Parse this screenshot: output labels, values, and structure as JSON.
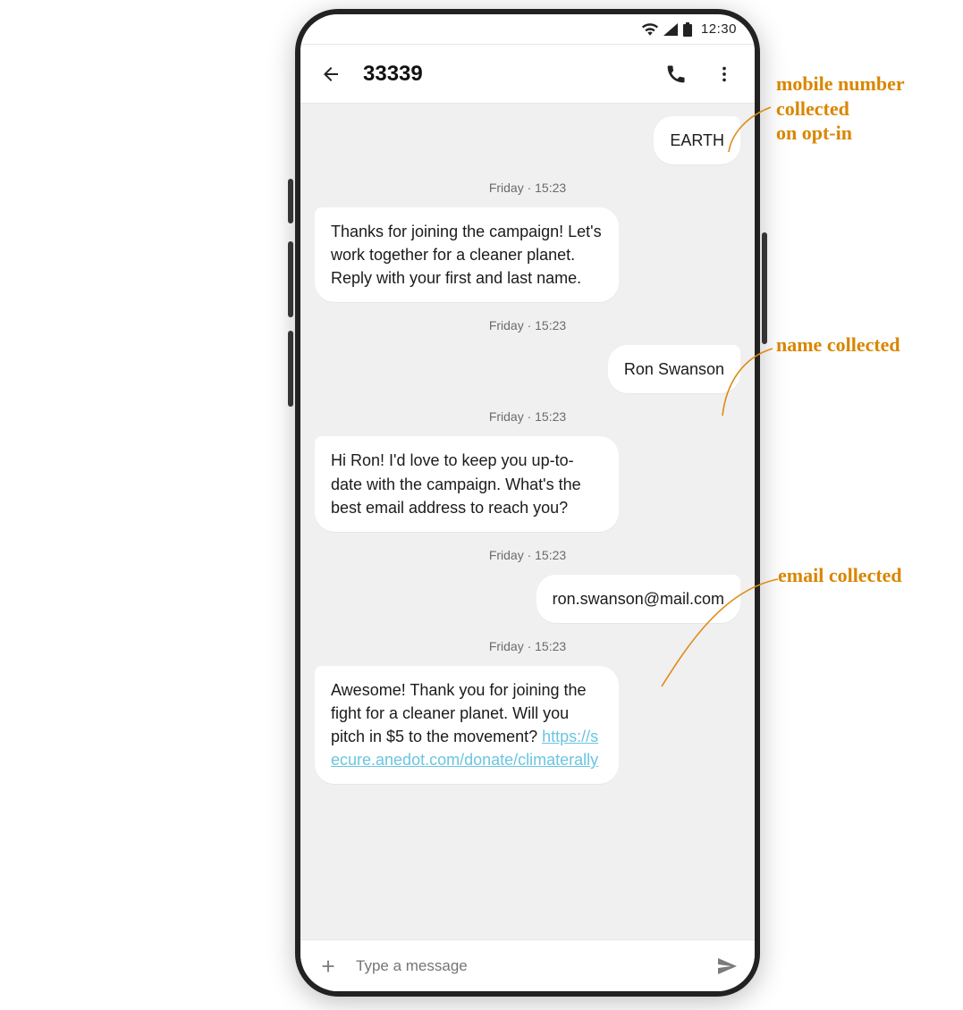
{
  "status": {
    "time": "12:30"
  },
  "header": {
    "title": "33339"
  },
  "thread": {
    "timestamps": {
      "t1": "Friday · 15:23",
      "t2": "Friday · 15:23",
      "t3": "Friday · 15:23",
      "t4": "Friday · 15:23",
      "t5": "Friday · 15:23"
    },
    "messages": {
      "m1_out": "EARTH",
      "m2_in": "Thanks for joining the campaign! Let's work together for a cleaner planet. Reply with your first and last name.",
      "m3_out": "Ron Swanson",
      "m4_in": "Hi Ron! I'd love to keep you up-to-date with the campaign. What's the best email address to reach you?",
      "m5_out": "ron.swanson@mail.com",
      "m6_in_text": "Awesome! Thank you for joining the fight for a cleaner planet. Will you pitch in $5 to the movement?",
      "m6_in_link": "https://secure.anedot.com/donate/climaterally"
    }
  },
  "composer": {
    "placeholder": "Type a message"
  },
  "annotations": {
    "a1_l1": "mobile number",
    "a1_l2": "collected",
    "a1_l3": "on opt-in",
    "a2": "name collected",
    "a3": "email collected"
  }
}
